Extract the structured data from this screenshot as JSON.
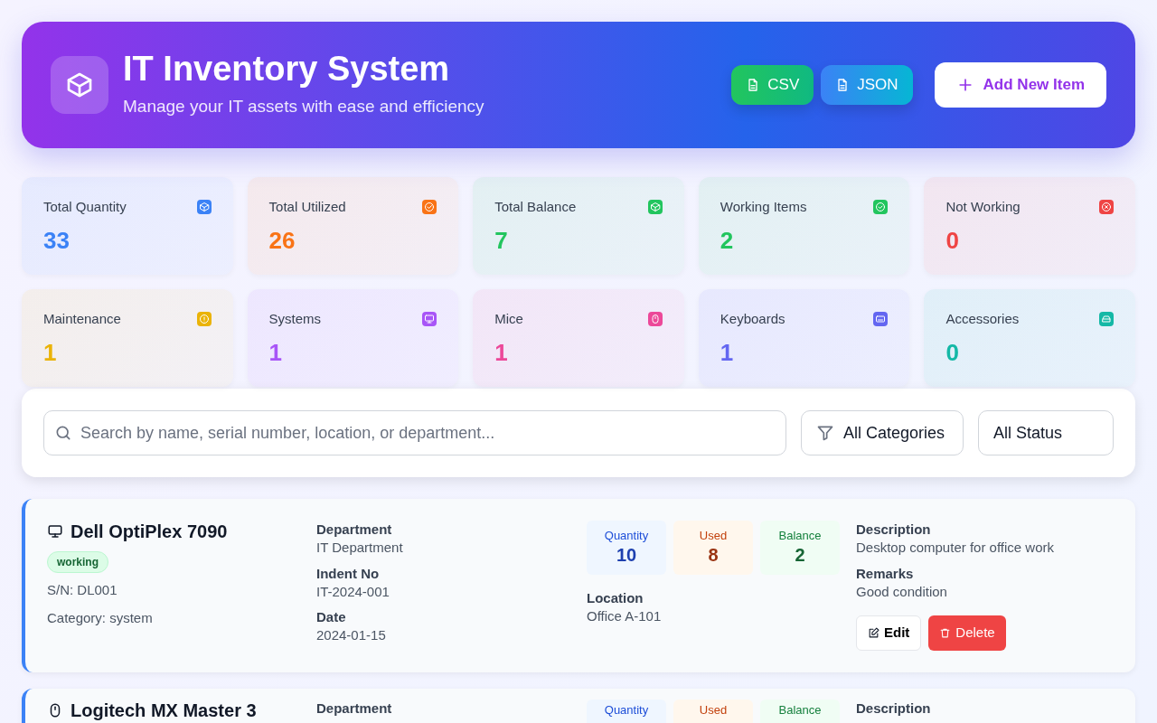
{
  "header": {
    "title": "IT Inventory System",
    "subtitle": "Manage your IT assets with ease and efficiency",
    "export_buttons": [
      "CSV",
      "JSON"
    ],
    "add_button": "Add New Item"
  },
  "stats": [
    {
      "label": "Total Quantity",
      "value": "33",
      "kind": "box",
      "color": "#3b82f6"
    },
    {
      "label": "Total Utilized",
      "value": "26",
      "kind": "target",
      "color": "#f97316"
    },
    {
      "label": "Total Balance",
      "value": "7",
      "kind": "box",
      "color": "#22c55e"
    },
    {
      "label": "Working Items",
      "value": "2",
      "kind": "check",
      "color": "#22c55e"
    },
    {
      "label": "Not Working",
      "value": "0",
      "kind": "cross",
      "color": "#ef4444"
    },
    {
      "label": "Maintenance",
      "value": "1",
      "kind": "alert",
      "color": "#eab308"
    },
    {
      "label": "Systems",
      "value": "1",
      "kind": "monitor",
      "color": "#a855f7"
    },
    {
      "label": "Mice",
      "value": "1",
      "kind": "mouse",
      "color": "#ec4899"
    },
    {
      "label": "Keyboards",
      "value": "1",
      "kind": "keyboard",
      "color": "#6366f1"
    },
    {
      "label": "Accessories",
      "value": "0",
      "kind": "drive",
      "color": "#14b8a6"
    }
  ],
  "filters": {
    "search": {
      "placeholder": "Search by name, serial number, location, or department..."
    },
    "category": "All Categories",
    "status": "All Status"
  },
  "items": [
    {
      "kind": "monitor",
      "name": "Dell OptiPlex 7090",
      "status": "working",
      "serial": "S/N: DL001",
      "category": "Category: system",
      "department_label": "Department",
      "department": "IT Department",
      "indent_label": "Indent No",
      "indent": "IT-2024-001",
      "date_label": "Date",
      "date": "2024-01-15",
      "quantity_label": "Quantity",
      "quantity": "10",
      "used_label": "Used",
      "used": "8",
      "balance_label": "Balance",
      "balance": "2",
      "location_label": "Location",
      "location": "Office A-101",
      "description_label": "Description",
      "description": "Desktop computer for office work",
      "remarks_label": "Remarks",
      "remarks": "Good condition",
      "edit": "Edit",
      "delete": "Delete"
    },
    {
      "kind": "mouse",
      "name": "Logitech MX Master 3",
      "department_label": "Department",
      "quantity_label": "Quantity",
      "used_label": "Used",
      "balance_label": "Balance",
      "description_label": "Description"
    }
  ]
}
